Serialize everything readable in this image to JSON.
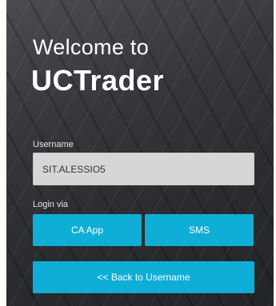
{
  "header": {
    "welcome_text": "Welcome to",
    "brand_name": "UCTrader"
  },
  "username": {
    "label": "Username",
    "value": "SIT.ALESSIO5"
  },
  "login_via": {
    "label": "Login via",
    "ca_app_label": "CA App",
    "sms_label": "SMS"
  },
  "back_button": {
    "label": "<< Back to Username"
  },
  "colors": {
    "accent": "#0eaed6",
    "input_background": "#d6d6d6",
    "panel_background": "#2f3135"
  }
}
